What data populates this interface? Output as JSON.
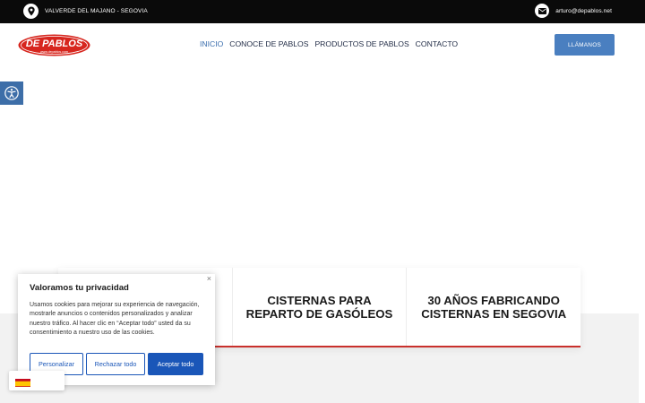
{
  "topbar": {
    "location": "VALVERDE DEL MAJANO - SEGOVIA",
    "email": "arturo@depablos.net",
    "icons": {
      "location": "map-pin-icon",
      "email": "envelope-icon"
    }
  },
  "header": {
    "logo_text": "DE PABLOS",
    "logo_subtext": "www.depablos.com",
    "nav": [
      {
        "label": "INICIO",
        "active": true
      },
      {
        "label": "CONOCE DE PABLOS",
        "active": false
      },
      {
        "label": "PRODUCTOS DE PABLOS",
        "active": false
      },
      {
        "label": "CONTACTO",
        "active": false
      }
    ],
    "call_button": "LLÁMANOS"
  },
  "accessibility": {
    "icon": "accessibility-icon"
  },
  "features": {
    "card2": [
      "CISTERNAS PARA",
      "REPARTO DE GASÓLEOS"
    ],
    "card3": [
      "30 AÑOS FABRICANDO",
      "CISTERNAS EN SEGOVIA"
    ]
  },
  "cookie": {
    "title": "Valoramos tu privacidad",
    "text": "Usamos cookies para mejorar su experiencia de navegación, mostrarle anuncios o contenidos personalizados y analizar nuestro tráfico. Al hacer clic en “Aceptar todo” usted da su consentimiento a nuestro uso de las cookies.",
    "close": "×",
    "buttons": {
      "customize": "Personalizar",
      "reject": "Rechazar todo",
      "accept": "Aceptar todo"
    }
  },
  "language": {
    "flag": "spain-flag-icon"
  },
  "colors": {
    "topbar": "#0a0a0a",
    "accent_blue": "#4a7fc0",
    "nav_active": "#3c6fae",
    "logo_red": "#d7261e",
    "card_border": "#c9302c",
    "cookie_blue": "#1a56b8"
  }
}
